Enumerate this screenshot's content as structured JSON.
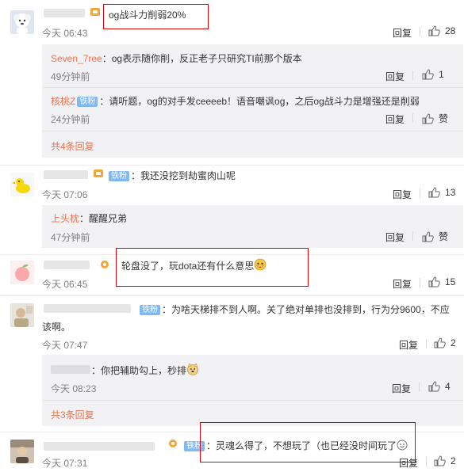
{
  "comments": [
    {
      "text": "og战斗力削弱20%",
      "time": "今天 06:43",
      "reply": "回复",
      "likes": "28",
      "replies": [
        {
          "user": "Seven_7ree",
          "text": "：og表示随你削，反正老子只研究TI前那个版本",
          "time": "49分钟前",
          "reply": "回复",
          "likes": "1"
        },
        {
          "user": "核桃Z",
          "badge": "铁粉",
          "text": "：请听题，og的对手发ceeeeb！语音嘲讽og，之后og战斗力是增强还是削弱",
          "time": "24分钟前",
          "reply": "回复",
          "likes": "赞"
        }
      ],
      "more": "共4条回复"
    },
    {
      "badge": "铁粉",
      "text": "：我还没挖到劫蜜肉山呢",
      "time": "今天 07:06",
      "reply": "回复",
      "likes": "13",
      "replies": [
        {
          "user": "上头枕",
          "text": "：醒醒兄弟",
          "time": "47分钟前",
          "reply": "回复",
          "likes": "赞"
        }
      ]
    },
    {
      "text": "轮盘没了，玩dota还有什么意思",
      "time": "今天 06:45",
      "reply": "回复",
      "likes": "15"
    },
    {
      "badge": "铁粉",
      "text_line1": "：为啥天梯排不到人啊。关了绝对单排也没排到，行为分9600，不应",
      "text_line2": "该啊。",
      "time": "今天 07:47",
      "reply": "回复",
      "likes": "2",
      "replies": [
        {
          "text": "：你把辅助勾上，秒排",
          "time": "今天 08:23",
          "reply": "回复",
          "likes": "4"
        }
      ],
      "more": "共3条回复"
    },
    {
      "badge": "铁粉",
      "text": "：灵魂么得了，不想玩了（也已经没时间玩了",
      "time": "今天 07:31",
      "reply": "回复",
      "likes": "2"
    }
  ],
  "colors": {
    "username": "#eb7350",
    "badge": "#80b9f2",
    "highlight_box": "#e0000a"
  }
}
